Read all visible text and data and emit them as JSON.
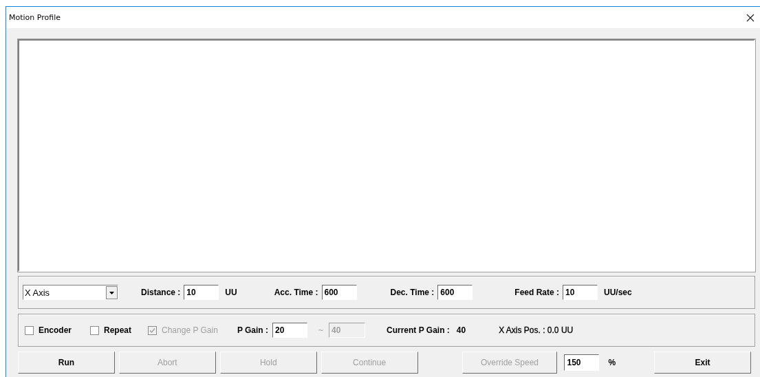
{
  "window": {
    "title": "Motion Profile"
  },
  "parameters": {
    "axis_select": {
      "value": "X Axis"
    },
    "fields": [
      {
        "label": "Distance :",
        "value": "10",
        "unit": "UU"
      },
      {
        "label": "Acc. Time :",
        "value": "600"
      },
      {
        "label": "Dec. Time :",
        "value": "600"
      },
      {
        "label": "Feed Rate :",
        "value": "10",
        "unit": "UU/sec"
      }
    ]
  },
  "options": {
    "checkboxes": [
      {
        "label": "Encoder",
        "checked": false,
        "disabled": false
      },
      {
        "label": "Repeat",
        "checked": false,
        "disabled": false
      },
      {
        "label": "Change P Gain",
        "checked": true,
        "disabled": true
      }
    ],
    "p_gain": {
      "label": "P Gain :",
      "value": "20",
      "separator": "~",
      "max_value": "40",
      "max_disabled": true
    },
    "current_p_gain": {
      "label": "Current P Gain :",
      "value": "40"
    },
    "position": "X Axis Pos. : 0.0 UU"
  },
  "buttons": [
    {
      "label": "Run",
      "disabled": false
    },
    {
      "label": "Abort",
      "disabled": true
    },
    {
      "label": "Hold",
      "disabled": true
    },
    {
      "label": "Continue",
      "disabled": true
    }
  ],
  "override": {
    "label": "Override Speed",
    "disabled": true,
    "value": "150",
    "unit": "%"
  },
  "exit_button": {
    "label": "Exit",
    "disabled": false
  }
}
